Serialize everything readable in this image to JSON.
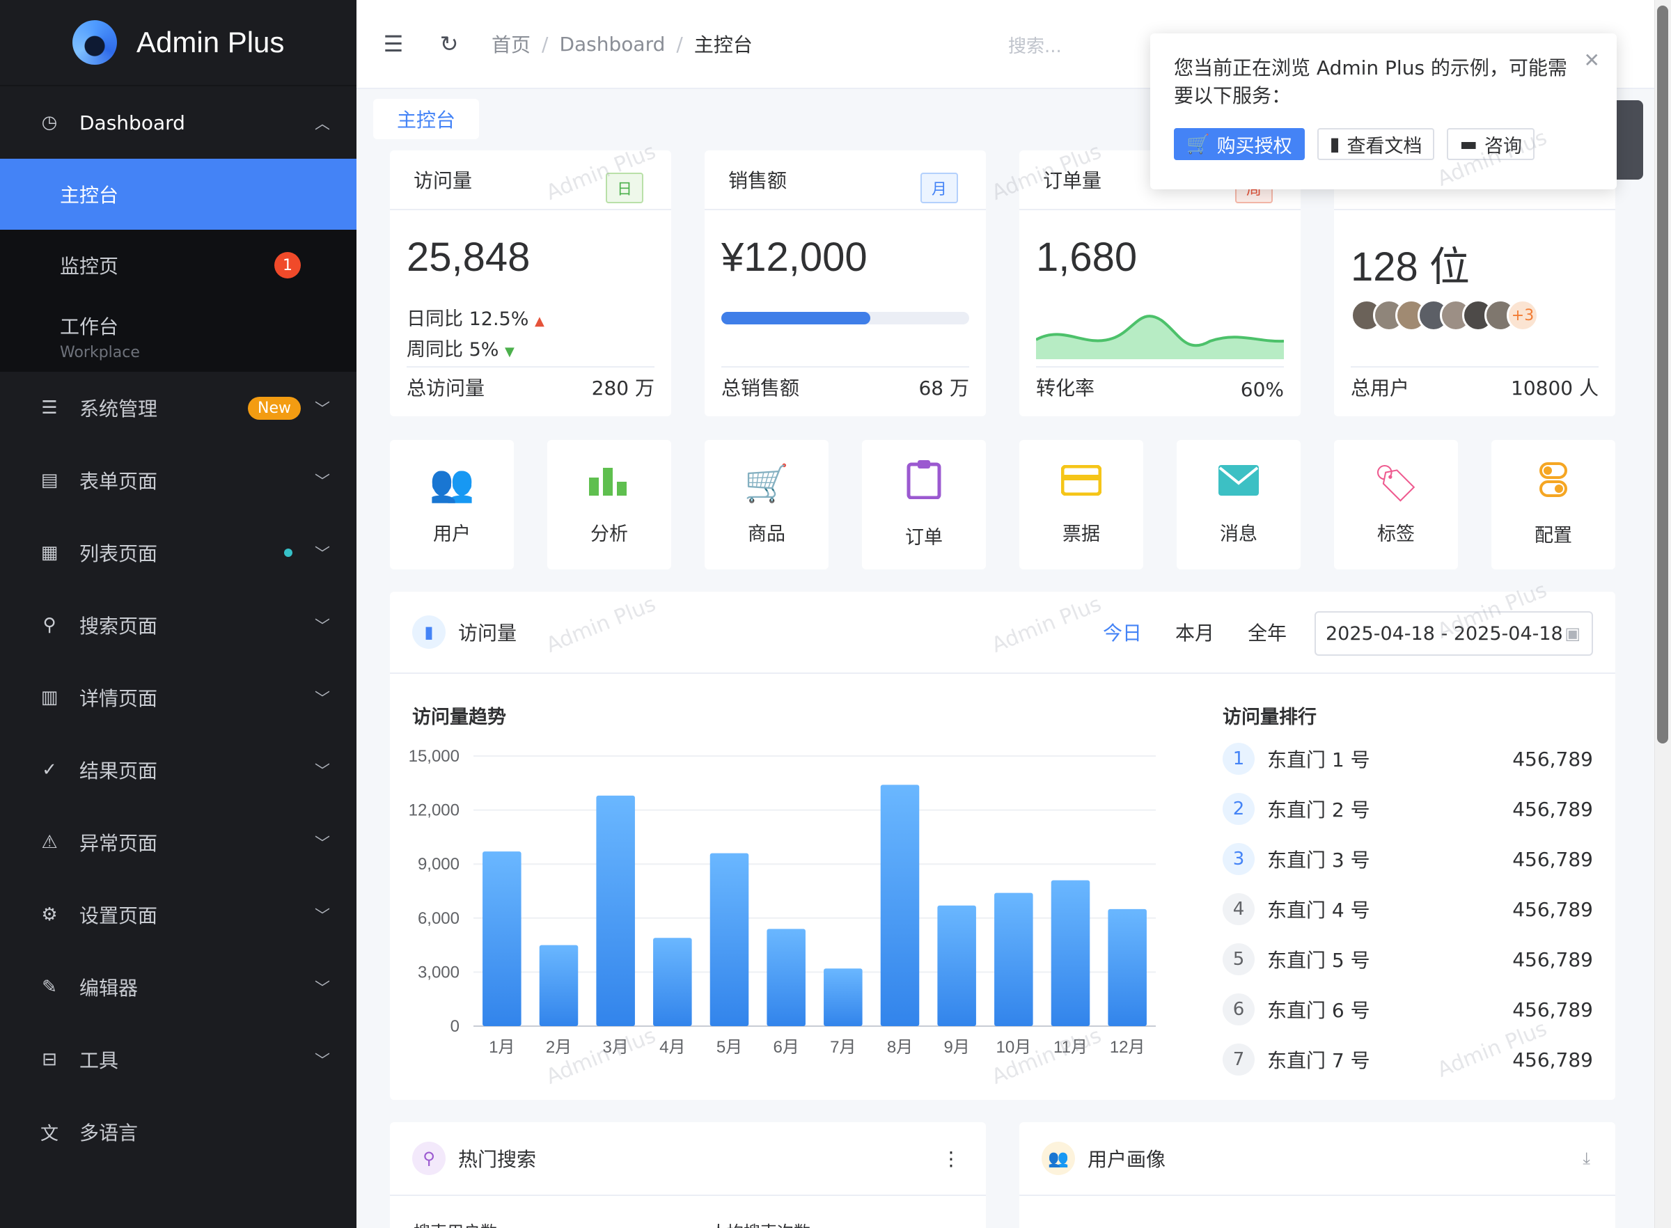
{
  "app": {
    "name": "Admin Plus"
  },
  "sidebar": {
    "dashboard": {
      "label": "Dashboard"
    },
    "sub_items": [
      {
        "label": "主控台"
      },
      {
        "label": "监控页",
        "badge": "1"
      },
      {
        "label": "工作台",
        "sublabel": "Workplace"
      }
    ],
    "items": [
      {
        "label": "系统管理",
        "badge": "New",
        "icon": "sliders-icon"
      },
      {
        "label": "表单页面",
        "icon": "form-icon"
      },
      {
        "label": "列表页面",
        "icon": "table-icon"
      },
      {
        "label": "搜索页面",
        "icon": "search-icon"
      },
      {
        "label": "详情页面",
        "icon": "detail-icon"
      },
      {
        "label": "结果页面",
        "icon": "check-circle-icon"
      },
      {
        "label": "异常页面",
        "icon": "warning-icon"
      },
      {
        "label": "设置页面",
        "icon": "settings-icon"
      },
      {
        "label": "编辑器",
        "icon": "edit-icon"
      },
      {
        "label": "工具",
        "icon": "toolbox-icon"
      },
      {
        "label": "多语言",
        "icon": "translate-icon"
      }
    ]
  },
  "header": {
    "breadcrumb": [
      "首页",
      "Dashboard",
      "主控台"
    ],
    "search_placeholder": "搜索..."
  },
  "tabs": {
    "active": "主控台"
  },
  "stats": [
    {
      "title": "访问量",
      "tag": "日",
      "value": "25,848",
      "day_cmp_label": "日同比",
      "day_cmp": "12.5%",
      "week_cmp_label": "周同比",
      "week_cmp": "5%",
      "foot_label": "总访问量",
      "foot_value": "280 万"
    },
    {
      "title": "销售额",
      "tag": "月",
      "value": "¥12,000",
      "progress": 0.6,
      "foot_label": "总销售额",
      "foot_value": "68 万"
    },
    {
      "title": "订单量",
      "tag": "周",
      "value": "1,680",
      "foot_label": "转化率",
      "foot_value": "60%"
    },
    {
      "title": "",
      "value": "128 位",
      "avatars_more": "+3",
      "foot_label": "总用户",
      "foot_value": "10800 人"
    }
  ],
  "shortcuts": [
    {
      "label": "用户",
      "icon": "users-icon",
      "color": "#4483f6"
    },
    {
      "label": "分析",
      "icon": "bar-chart-icon",
      "color": "#5fbf4f"
    },
    {
      "label": "商品",
      "icon": "cart-icon",
      "color": "#f27c34"
    },
    {
      "label": "订单",
      "icon": "clipboard-icon",
      "color": "#9b59d0"
    },
    {
      "label": "票据",
      "icon": "card-icon",
      "color": "#f5c518"
    },
    {
      "label": "消息",
      "icon": "mail-icon",
      "color": "#3cc0c4"
    },
    {
      "label": "标签",
      "icon": "tag-icon",
      "color": "#ee5a8f"
    },
    {
      "label": "配置",
      "icon": "toggle-icon",
      "color": "#f5a623"
    }
  ],
  "visits": {
    "title": "访问量",
    "ranges": [
      "今日",
      "本月",
      "全年"
    ],
    "active_range": "今日",
    "date_range": "2025-04-18 - 2025-04-18",
    "trend_title": "访问量趋势",
    "rank_title": "访问量排行",
    "rank": [
      {
        "rank": "1",
        "name": "东直门 1 号",
        "value": "456,789"
      },
      {
        "rank": "2",
        "name": "东直门 2 号",
        "value": "456,789"
      },
      {
        "rank": "3",
        "name": "东直门 3 号",
        "value": "456,789"
      },
      {
        "rank": "4",
        "name": "东直门 4 号",
        "value": "456,789"
      },
      {
        "rank": "5",
        "name": "东直门 5 号",
        "value": "456,789"
      },
      {
        "rank": "6",
        "name": "东直门 6 号",
        "value": "456,789"
      },
      {
        "rank": "7",
        "name": "东直门 7 号",
        "value": "456,789"
      }
    ]
  },
  "bottom": {
    "hot_search": "热门搜索",
    "user_profile": "用户画像",
    "hot_sub1": "搜索用户数",
    "hot_sub2": "人均搜索次数"
  },
  "popup": {
    "message": "您当前正在浏览 Admin Plus 的示例，可能需要以下服务：",
    "buttons": [
      "购买授权",
      "查看文档",
      "咨询"
    ]
  },
  "watermark": "Admin Plus",
  "chart_data": {
    "type": "bar",
    "title": "访问量趋势",
    "categories": [
      "1月",
      "2月",
      "3月",
      "4月",
      "5月",
      "6月",
      "7月",
      "8月",
      "9月",
      "10月",
      "11月",
      "12月"
    ],
    "values": [
      9700,
      4500,
      12800,
      4900,
      9600,
      5400,
      3200,
      13400,
      6700,
      7400,
      8100,
      6500
    ],
    "ylim": [
      0,
      15000
    ],
    "yticks": [
      "0",
      "3,000",
      "6,000",
      "9,000",
      "12,000",
      "15,000"
    ],
    "color": "#3f8ef0"
  }
}
